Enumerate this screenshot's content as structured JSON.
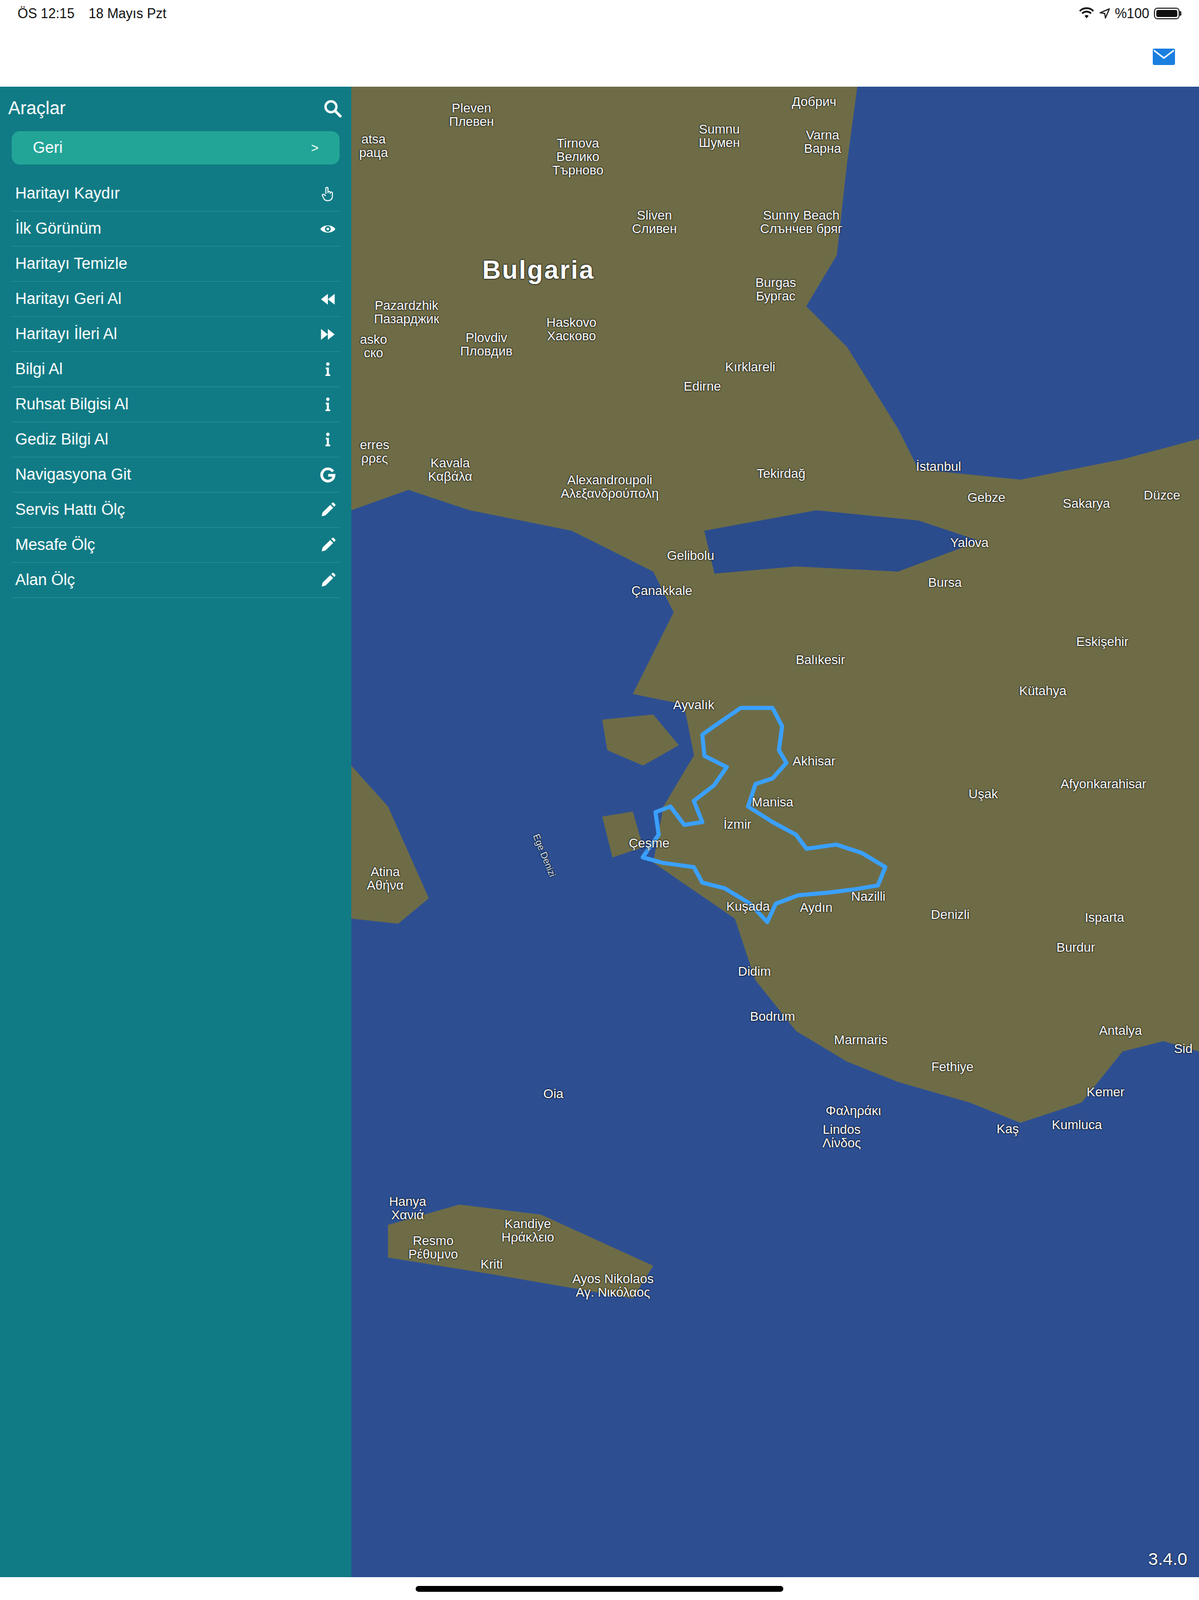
{
  "status_bar": {
    "time": "ÖS 12:15",
    "date": "18 Mayıs Pzt",
    "battery": "%100",
    "battery_level": 1.0
  },
  "sidebar": {
    "title": "Araçlar",
    "back_button": {
      "label": "Geri",
      "arrow": ">"
    },
    "items": [
      {
        "label": "Haritayı Kaydır"
      },
      {
        "label": "İlk Görünüm"
      },
      {
        "label": "Haritayı Temizle"
      },
      {
        "label": "Haritayı Geri Al"
      },
      {
        "label": "Haritayı İleri Al"
      },
      {
        "label": "Bilgi Al"
      },
      {
        "label": "Ruhsat Bilgisi Al"
      },
      {
        "label": "Gediz Bilgi Al"
      },
      {
        "label": "Navigasyona Git"
      },
      {
        "label": "Servis Hattı Ölç"
      },
      {
        "label": "Mesafe Ölç"
      },
      {
        "label": "Alan Ölç"
      }
    ]
  },
  "map": {
    "labels": [
      {
        "lines": [
          "Pleven",
          "Плевен"
        ],
        "lon": 24.61,
        "lat": 43.36,
        "kind": "city"
      },
      {
        "lines": [
          "Добрич"
        ],
        "lon": 27.83,
        "lat": 43.45,
        "kind": "city"
      },
      {
        "lines": [
          "Varna",
          "Варна"
        ],
        "lon": 27.91,
        "lat": 43.17,
        "kind": "city"
      },
      {
        "lines": [
          "Tirnova",
          "Велико",
          "Търново"
        ],
        "lon": 25.61,
        "lat": 43.06,
        "kind": "city"
      },
      {
        "lines": [
          "Sumnu",
          "Шумен"
        ],
        "lon": 26.94,
        "lat": 43.21,
        "kind": "city"
      },
      {
        "lines": [
          "Sliven",
          "Сливен"
        ],
        "lon": 26.33,
        "lat": 42.6,
        "kind": "city"
      },
      {
        "lines": [
          "Sunny Beach",
          "Слънчев бряг"
        ],
        "lon": 27.71,
        "lat": 42.6,
        "kind": "city"
      },
      {
        "lines": [
          "Bulgaria"
        ],
        "lon": 25.24,
        "lat": 42.26,
        "kind": "country"
      },
      {
        "lines": [
          "Burgas",
          "Бургас"
        ],
        "lon": 27.47,
        "lat": 42.12,
        "kind": "city"
      },
      {
        "lines": [
          "Pazardzhik",
          "Пазарджик"
        ],
        "lon": 24.0,
        "lat": 41.96,
        "kind": "city"
      },
      {
        "lines": [
          "Plovdiv",
          "Пловдив"
        ],
        "lon": 24.75,
        "lat": 41.73,
        "kind": "city"
      },
      {
        "lines": [
          "Haskovo",
          "Хасково"
        ],
        "lon": 25.55,
        "lat": 41.84,
        "kind": "city"
      },
      {
        "lines": [
          "Kırklareli"
        ],
        "lon": 27.23,
        "lat": 41.57,
        "kind": "city"
      },
      {
        "lines": [
          "Edirne"
        ],
        "lon": 26.78,
        "lat": 41.43,
        "kind": "city"
      },
      {
        "lines": [
          "Kavala",
          "Καβάλα"
        ],
        "lon": 24.41,
        "lat": 40.84,
        "kind": "city"
      },
      {
        "lines": [
          "Alexandroupoli",
          "Αλεξανδρούπολη"
        ],
        "lon": 25.91,
        "lat": 40.72,
        "kind": "city"
      },
      {
        "lines": [
          "Tekirdağ"
        ],
        "lon": 27.52,
        "lat": 40.81,
        "kind": "city"
      },
      {
        "lines": [
          "İstanbul"
        ],
        "lon": 29.0,
        "lat": 40.86,
        "kind": "city"
      },
      {
        "lines": [
          "Gebze"
        ],
        "lon": 29.45,
        "lat": 40.64,
        "kind": "city"
      },
      {
        "lines": [
          "Sakarya"
        ],
        "lon": 30.39,
        "lat": 40.6,
        "kind": "city"
      },
      {
        "lines": [
          "Düzce"
        ],
        "lon": 31.1,
        "lat": 40.66,
        "kind": "city"
      },
      {
        "lines": [
          "Yalova"
        ],
        "lon": 29.29,
        "lat": 40.32,
        "kind": "city"
      },
      {
        "lines": [
          "Gelibolu"
        ],
        "lon": 26.67,
        "lat": 40.23,
        "kind": "city"
      },
      {
        "lines": [
          "Bursa"
        ],
        "lon": 29.06,
        "lat": 40.04,
        "kind": "city"
      },
      {
        "lines": [
          "Çanakkale"
        ],
        "lon": 26.4,
        "lat": 39.98,
        "kind": "city"
      },
      {
        "lines": [
          "Eskişehir"
        ],
        "lon": 30.54,
        "lat": 39.62,
        "kind": "city"
      },
      {
        "lines": [
          "Balıkesir"
        ],
        "lon": 27.89,
        "lat": 39.49,
        "kind": "city"
      },
      {
        "lines": [
          "Kütahya"
        ],
        "lon": 29.98,
        "lat": 39.27,
        "kind": "city"
      },
      {
        "lines": [
          "Ayvalık"
        ],
        "lon": 26.7,
        "lat": 39.17,
        "kind": "city"
      },
      {
        "lines": [
          "Akhisar"
        ],
        "lon": 27.83,
        "lat": 38.77,
        "kind": "city"
      },
      {
        "lines": [
          "Manisa"
        ],
        "lon": 27.44,
        "lat": 38.48,
        "kind": "city"
      },
      {
        "lines": [
          "Uşak"
        ],
        "lon": 29.42,
        "lat": 38.54,
        "kind": "city"
      },
      {
        "lines": [
          "Afyonkarahisar"
        ],
        "lon": 30.55,
        "lat": 38.61,
        "kind": "city"
      },
      {
        "lines": [
          "İzmir"
        ],
        "lon": 27.11,
        "lat": 38.32,
        "kind": "city"
      },
      {
        "lines": [
          "Çeşme"
        ],
        "lon": 26.28,
        "lat": 38.19,
        "kind": "city"
      },
      {
        "lines": [
          "Ege Denizi"
        ],
        "lon": 25.29,
        "lat": 38.1,
        "kind": "sea"
      },
      {
        "lines": [
          "Atina",
          "Αθήνα"
        ],
        "lon": 23.8,
        "lat": 37.94,
        "kind": "city"
      },
      {
        "lines": [
          "Kuşada"
        ],
        "lon": 27.21,
        "lat": 37.74,
        "kind": "city"
      },
      {
        "lines": [
          "Aydın"
        ],
        "lon": 27.85,
        "lat": 37.73,
        "kind": "city"
      },
      {
        "lines": [
          "Nazilli"
        ],
        "lon": 28.34,
        "lat": 37.81,
        "kind": "city"
      },
      {
        "lines": [
          "Denizli"
        ],
        "lon": 29.11,
        "lat": 37.68,
        "kind": "city"
      },
      {
        "lines": [
          "Isparta"
        ],
        "lon": 30.56,
        "lat": 37.66,
        "kind": "city"
      },
      {
        "lines": [
          "Burdur"
        ],
        "lon": 30.29,
        "lat": 37.45,
        "kind": "city"
      },
      {
        "lines": [
          "Didim"
        ],
        "lon": 27.27,
        "lat": 37.28,
        "kind": "city"
      },
      {
        "lines": [
          "Bodrum"
        ],
        "lon": 27.44,
        "lat": 36.96,
        "kind": "city"
      },
      {
        "lines": [
          "Marmaris"
        ],
        "lon": 28.27,
        "lat": 36.79,
        "kind": "city"
      },
      {
        "lines": [
          "Fethiye"
        ],
        "lon": 29.13,
        "lat": 36.6,
        "kind": "city"
      },
      {
        "lines": [
          "Antalya"
        ],
        "lon": 30.71,
        "lat": 36.86,
        "kind": "city"
      },
      {
        "lines": [
          "Sid"
        ],
        "lon": 31.3,
        "lat": 36.73,
        "kind": "city"
      },
      {
        "lines": [
          "Kemer"
        ],
        "lon": 30.57,
        "lat": 36.42,
        "kind": "city"
      },
      {
        "lines": [
          "Kumluca"
        ],
        "lon": 30.3,
        "lat": 36.19,
        "kind": "city"
      },
      {
        "lines": [
          "Kaş"
        ],
        "lon": 29.65,
        "lat": 36.16,
        "kind": "city"
      },
      {
        "lines": [
          "Φαληράκι"
        ],
        "lon": 28.2,
        "lat": 36.29,
        "kind": "city"
      },
      {
        "lines": [
          "Lindos",
          "Λίνδος"
        ],
        "lon": 28.09,
        "lat": 36.11,
        "kind": "city"
      },
      {
        "lines": [
          "Oia"
        ],
        "lon": 25.38,
        "lat": 36.41,
        "kind": "city"
      },
      {
        "lines": [
          "Hanya",
          "Χανιά"
        ],
        "lon": 24.01,
        "lat": 35.6,
        "kind": "city"
      },
      {
        "lines": [
          "Resmo",
          "Ρέθυμνο"
        ],
        "lon": 24.25,
        "lat": 35.32,
        "kind": "city"
      },
      {
        "lines": [
          "Kandiye",
          "Ηράκλειο"
        ],
        "lon": 25.14,
        "lat": 35.44,
        "kind": "city"
      },
      {
        "lines": [
          "Kriti"
        ],
        "lon": 24.8,
        "lat": 35.2,
        "kind": "city"
      },
      {
        "lines": [
          "Ayos Nikolaos",
          "Αγ. Νικόλαος"
        ],
        "lon": 25.94,
        "lat": 35.05,
        "kind": "city"
      },
      {
        "lines": [
          "atsa",
          "раца"
        ],
        "lon": 23.69,
        "lat": 43.14,
        "kind": "city"
      },
      {
        "lines": [
          "erres",
          "ρρες"
        ],
        "lon": 23.7,
        "lat": 40.97,
        "kind": "city"
      },
      {
        "lines": [
          "asko",
          "ско"
        ],
        "lon": 23.69,
        "lat": 41.72,
        "kind": "city"
      }
    ],
    "region": {
      "points": [
        [
          26.89,
          39.02
        ],
        [
          27.14,
          39.15
        ],
        [
          27.44,
          39.15
        ],
        [
          27.53,
          39.02
        ],
        [
          27.5,
          38.85
        ],
        [
          27.57,
          38.76
        ],
        [
          27.44,
          38.65
        ],
        [
          27.28,
          38.61
        ],
        [
          27.21,
          38.45
        ],
        [
          27.44,
          38.34
        ],
        [
          27.66,
          38.25
        ],
        [
          27.76,
          38.15
        ],
        [
          28.04,
          38.18
        ],
        [
          28.28,
          38.12
        ],
        [
          28.5,
          38.02
        ],
        [
          28.43,
          37.89
        ],
        [
          28.19,
          37.86
        ],
        [
          27.97,
          37.84
        ],
        [
          27.68,
          37.82
        ],
        [
          27.47,
          37.76
        ],
        [
          27.39,
          37.63
        ],
        [
          27.23,
          37.76
        ],
        [
          26.99,
          37.87
        ],
        [
          26.78,
          37.91
        ],
        [
          26.7,
          38.02
        ],
        [
          26.41,
          38.05
        ],
        [
          26.22,
          38.09
        ],
        [
          26.37,
          38.25
        ],
        [
          26.34,
          38.41
        ],
        [
          26.48,
          38.45
        ],
        [
          26.61,
          38.32
        ],
        [
          26.78,
          38.34
        ],
        [
          26.7,
          38.49
        ],
        [
          26.89,
          38.6
        ],
        [
          27.01,
          38.73
        ],
        [
          26.8,
          38.81
        ],
        [
          26.78,
          38.96
        ]
      ]
    }
  },
  "version": "3.4.0"
}
